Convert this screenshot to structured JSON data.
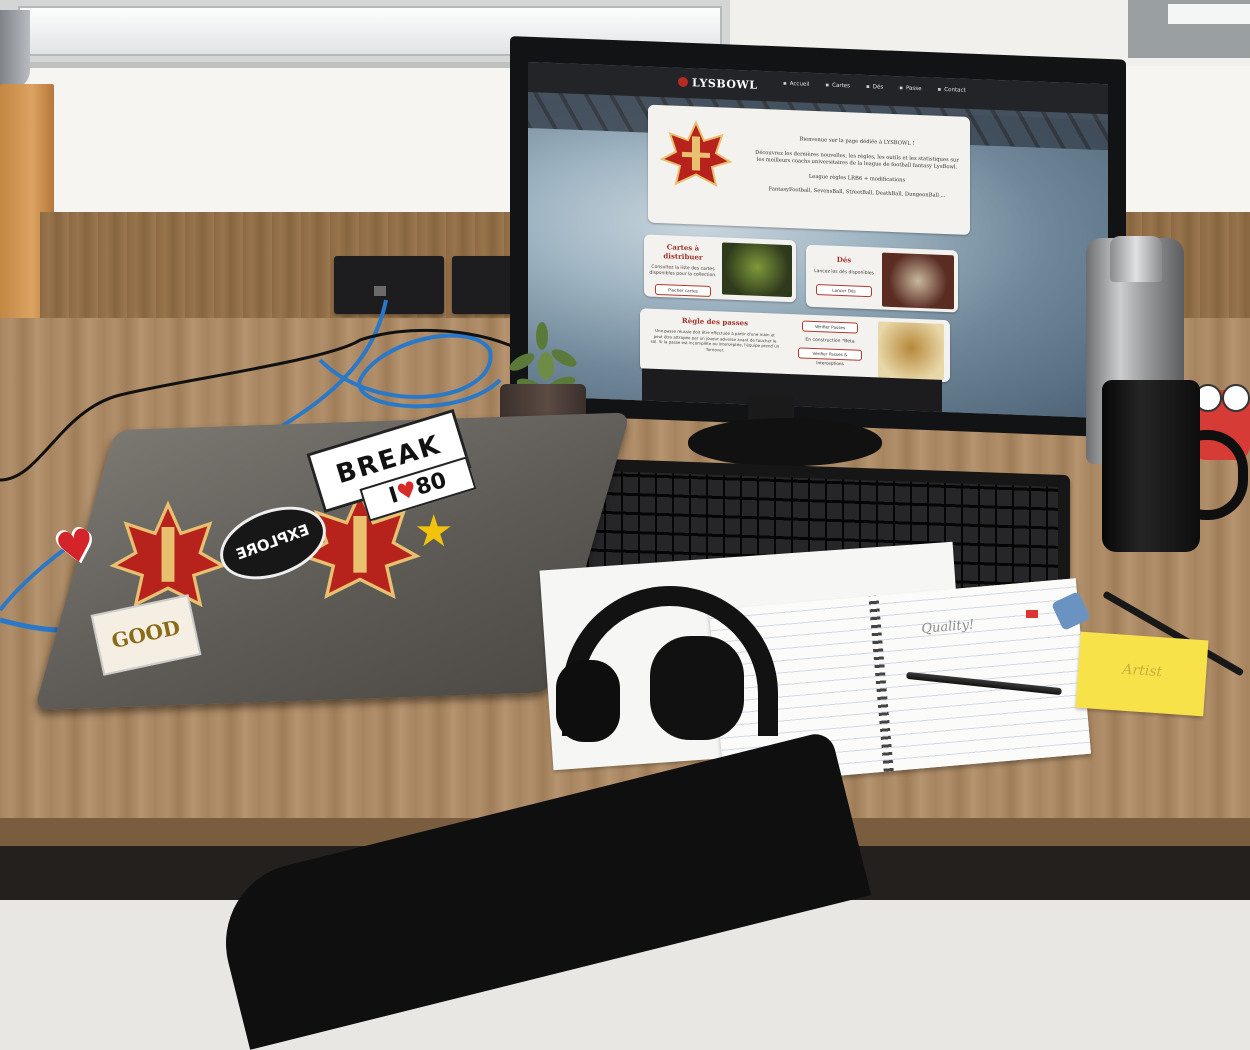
{
  "scene": "desk-with-monitor-showing-lysbowl-site",
  "website": {
    "brand": "LYSBOWL",
    "nav": [
      "Accueil",
      "Cartes",
      "Dés",
      "Passe",
      "Contact"
    ],
    "welcome": {
      "line1": "Bienvenue sur la page dédiée à LYSBOWL !",
      "line2": "Découvrez les dernières nouvelles, les règles, les outils et les statistiques sur les meilleurs coachs universitaires de la league de football fantasy LysBowl.",
      "line3": "League règles LRB6 + modifications",
      "line4": "FantasyFootball, SevensBall, StreetBall, DeathBall, DungeonBall ..."
    },
    "cards_panel": {
      "title": "Cartes à distribuer",
      "text": "Consultez la liste des cartes disponibles pour la collection.",
      "button": "Piocher cartes"
    },
    "dice_panel": {
      "title": "Dés",
      "text": "Lancez les dés disponibles",
      "button": "Lancer Dés"
    },
    "passes_panel": {
      "title": "Règle des passes",
      "text": "Une passe réussie doit être effectuée à partir d'une main et peut être attrapée par un joueur adverse avant de toucher le sol. Si la passe est incomplète ou interceptée, l'équipe prend un Turnover.",
      "button1": "Vérifier Passes",
      "note": "En construction *Beta",
      "button2": "Vérifier Passes & Interceptions"
    }
  },
  "laptop_stickers": {
    "break": "BREAK",
    "i80": "80",
    "explore": "EXPLORE",
    "good": "GOOD"
  },
  "notebook_text": "Quality!",
  "sticky_note_text": "Artist",
  "colors": {
    "accent_red": "#b52a22",
    "navbar": "#222428",
    "card_bg": "#f3f2ee"
  }
}
